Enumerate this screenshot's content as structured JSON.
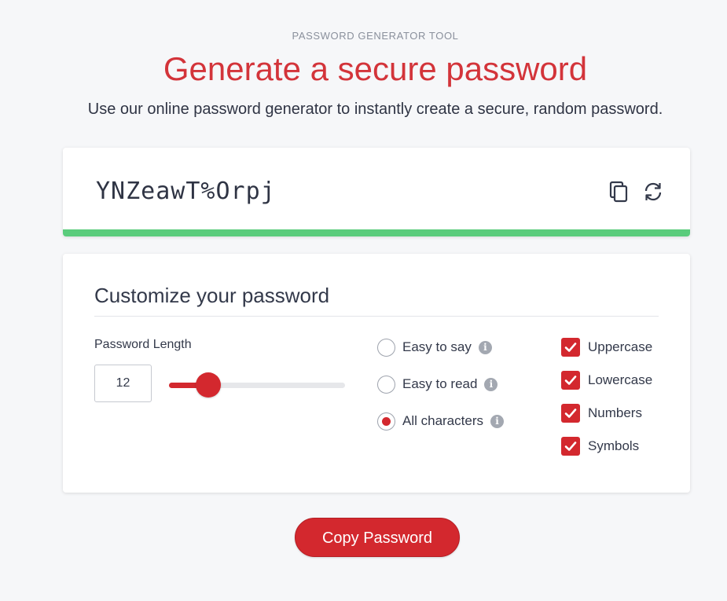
{
  "header": {
    "eyebrow": "PASSWORD GENERATOR TOOL",
    "title": "Generate a secure password",
    "subtitle": "Use our online password generator to instantly create a secure, random password."
  },
  "password_card": {
    "password": "YNZeawT%Orpj",
    "copy_icon": "copy-icon",
    "refresh_icon": "refresh-icon",
    "strength_color": "#5acc7c"
  },
  "customize": {
    "title": "Customize your password",
    "length_label": "Password Length",
    "length_value": "12",
    "length_min": 1,
    "length_max": 50,
    "radio_options": [
      {
        "label": "Easy to say",
        "checked": false
      },
      {
        "label": "Easy to read",
        "checked": false
      },
      {
        "label": "All characters",
        "checked": true
      }
    ],
    "checkbox_options": [
      {
        "label": "Uppercase",
        "checked": true
      },
      {
        "label": "Lowercase",
        "checked": true
      },
      {
        "label": "Numbers",
        "checked": true
      },
      {
        "label": "Symbols",
        "checked": true
      }
    ]
  },
  "copy_button": {
    "label": "Copy Password"
  },
  "colors": {
    "accent": "#d3282e",
    "title": "#d3343a",
    "strength": "#5acc7c"
  }
}
